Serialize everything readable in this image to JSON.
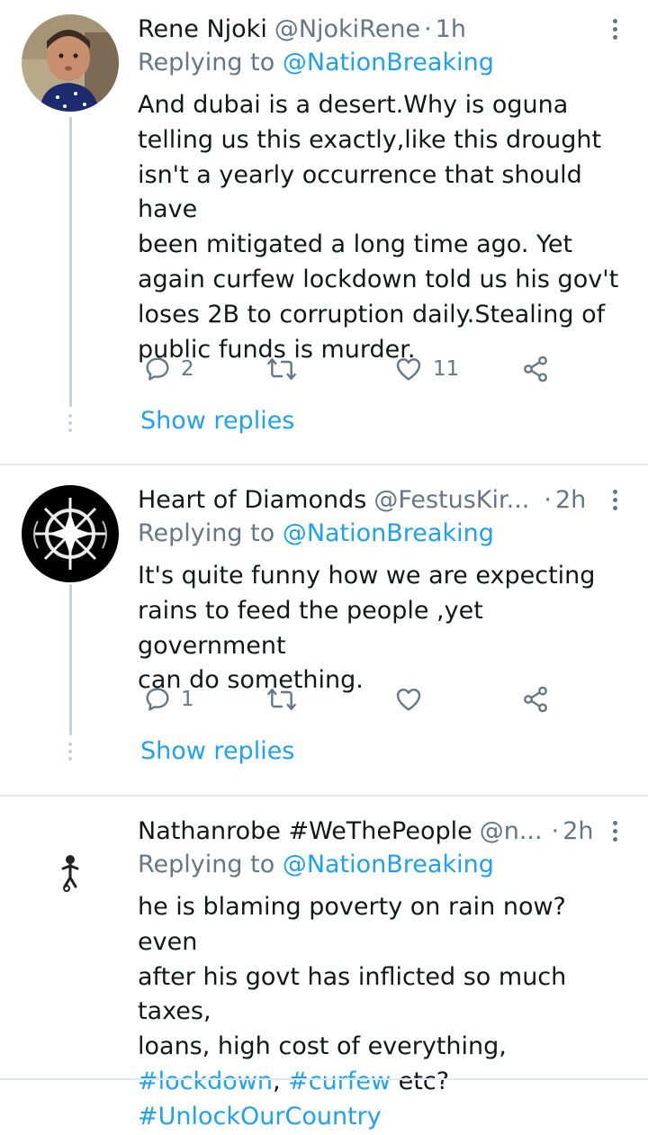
{
  "tweets": [
    {
      "name": "Rene Njoki",
      "handle": "@NjokiRene",
      "separator": "·",
      "time": "1h",
      "replying_prefix": "Replying to",
      "replying_to": "@NationBreaking",
      "body": "And dubai is a desert.Why is oguna\ntelling us this exactly,like this drought\nisn't a yearly occurrence that should have\nbeen mitigated a long time ago. Yet\nagain curfew lockdown told us his gov't\nloses 2B to corruption daily.Stealing of\npublic funds is murder.",
      "reply_count": "2",
      "retweet_count": "",
      "like_count": "11",
      "show_replies": "Show replies"
    },
    {
      "name": "Heart of Diamonds",
      "handle": "@FestusKir...",
      "separator": "·",
      "time": "2h",
      "replying_prefix": "Replying to",
      "replying_to": "@NationBreaking",
      "body": "It's quite funny how we are expecting\nrains to feed the people ,yet government\ncan do something.",
      "reply_count": "1",
      "retweet_count": "",
      "like_count": "",
      "show_replies": "Show replies"
    },
    {
      "name": "Nathanrobe #WeThePeople",
      "handle": "@n...",
      "separator": "·",
      "time": "2h",
      "replying_prefix": "Replying to",
      "replying_to": "@NationBreaking",
      "body_line1": "he is blaming poverty on rain now? even",
      "body_line2": "after his govt has inflicted so much taxes,",
      "body_line3": "loans, high cost of everything,",
      "hashtag1": "#lockdown",
      "comma": ",",
      "hashtag2": "#curfew",
      "etc": "etc?",
      "hashtag3": "#UnlockOurCountry"
    }
  ],
  "colors": {
    "link": "#1da1f2",
    "secondary_text": "#657786",
    "primary_text": "#14171a",
    "thread_line": "#c7d0d8"
  },
  "icons": [
    "reply-icon",
    "retweet-icon",
    "like-icon",
    "share-icon",
    "more-options-icon"
  ]
}
